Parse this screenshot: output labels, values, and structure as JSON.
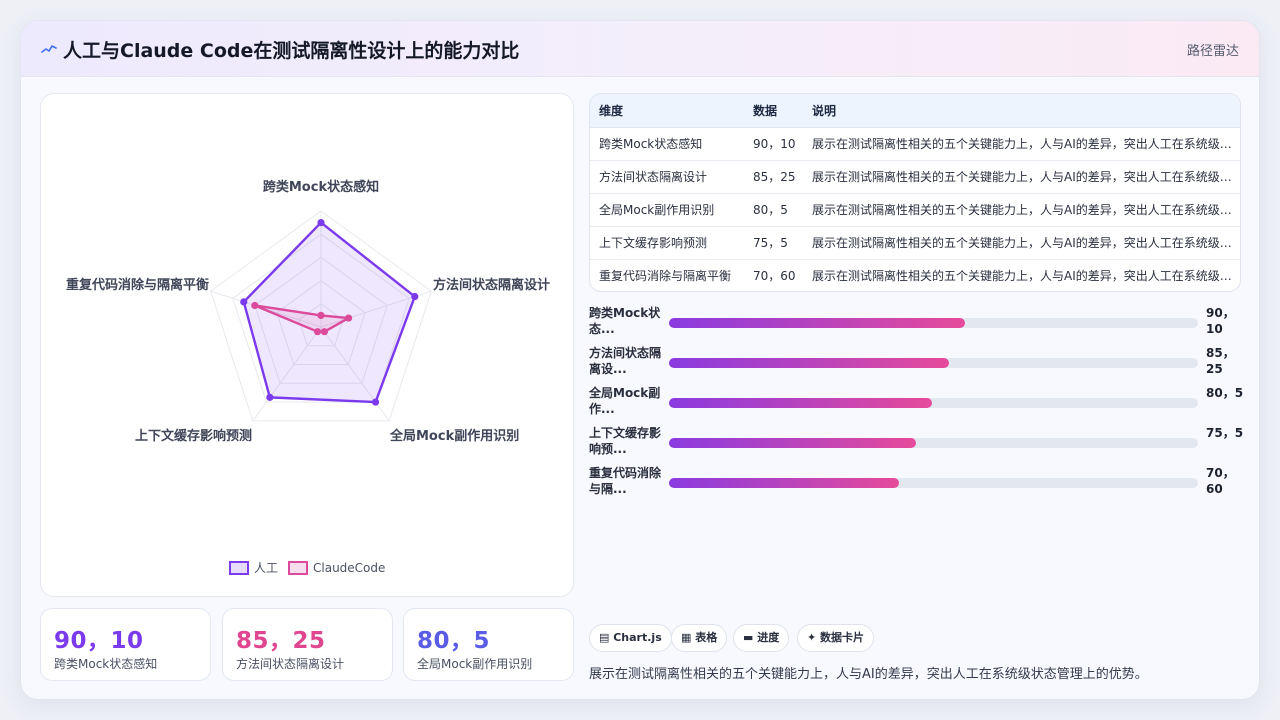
{
  "header": {
    "title": "人工与Claude Code在测试隔离性设计上的能力对比",
    "tag": "路径雷达",
    "icon": "sparkline-icon"
  },
  "chart_data": {
    "type": "radar",
    "axes": [
      "跨类Mock状态感知",
      "方法间状态隔离设计",
      "全局Mock副作用识别",
      "上下文缓存影响预测",
      "重复代码消除与隔离平衡"
    ],
    "rmax": 100,
    "rings": 5,
    "series": [
      {
        "name": "人工",
        "values": [
          90,
          85,
          80,
          75,
          70
        ],
        "color": "#7c3aed"
      },
      {
        "name": "ClaudeCode",
        "values": [
          10,
          25,
          5,
          5,
          60
        ],
        "color": "#db4a9b"
      }
    ],
    "legend": "bottom"
  },
  "table": {
    "headers": [
      "维度",
      "数据",
      "说明"
    ],
    "rows": [
      [
        "跨类Mock状态感知",
        "90，10",
        "展示在测试隔离性相关的五个关键能力上，人与AI的差异，突出人工在系统级状态管理上的优势。"
      ],
      [
        "方法间状态隔离设计",
        "85，25",
        "展示在测试隔离性相关的五个关键能力上，人与AI的差异，突出人工在系统级状态管理上的优势。"
      ],
      [
        "全局Mock副作用识别",
        "80，5",
        "展示在测试隔离性相关的五个关键能力上，人与AI的差异，突出人工在系统级状态管理上的优势。"
      ],
      [
        "上下文缓存影响预测",
        "75，5",
        "展示在测试隔离性相关的五个关键能力上，人与AI的差异，突出人工在系统级状态管理上的优势。"
      ],
      [
        "重复代码消除与隔离平衡",
        "70，60",
        "展示在测试隔离性相关的五个关键能力上，人与AI的差异，突出人工在系统级状态管理上的优势。"
      ]
    ]
  },
  "bars": [
    {
      "label": "跨类Mock状态...",
      "value": "90，10",
      "percent": 56
    },
    {
      "label": "方法间状态隔离设...",
      "value": "85，25",
      "percent": 53
    },
    {
      "label": "全局Mock副作...",
      "value": "80，5",
      "percent": 49.7
    },
    {
      "label": "上下文缓存影响预...",
      "value": "75，5",
      "percent": 46.6
    },
    {
      "label": "重复代码消除与隔...",
      "value": "70，60",
      "percent": 43.5
    }
  ],
  "stats": [
    {
      "value": "90，10",
      "label": "跨类Mock状态感知",
      "color": "#7c3aed"
    },
    {
      "value": "85，25",
      "label": "方法间状态隔离设计",
      "color": "#e0468f"
    },
    {
      "value": "80，5",
      "label": "全局Mock副作用识别",
      "color": "#5a5ce6"
    }
  ],
  "chips": [
    {
      "label": "Chart.js",
      "icon": "chart-icon"
    },
    {
      "label": "表格",
      "icon": "table-icon"
    },
    {
      "label": "进度",
      "icon": "progress-icon"
    },
    {
      "label": "数据卡片",
      "icon": "card-icon"
    }
  ],
  "description": "展示在测试隔离性相关的五个关键能力上，人与AI的差异，突出人工在系统级状态管理上的优势。"
}
